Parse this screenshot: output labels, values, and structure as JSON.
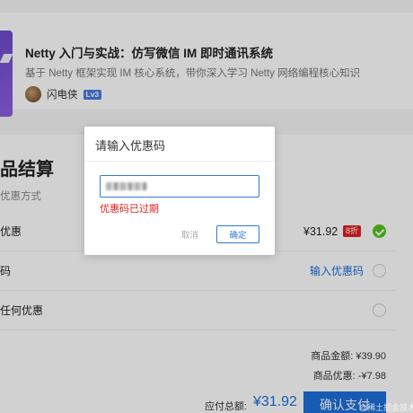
{
  "course": {
    "title": "Netty 入门与实战：仿写微信 IM 即时通讯系统",
    "description": "基于 Netty 框架实现 IM 核心系统，带你深入学习 Netty 网络编程核心知识",
    "author": "闪电侠",
    "level": "Lv3"
  },
  "settlement": {
    "title": "品结算",
    "subtitle": "优惠方式"
  },
  "options": [
    {
      "label": "优惠",
      "price": "¥31.92",
      "badge": "8折",
      "selected": true
    },
    {
      "label": "码",
      "link": "输入优惠码",
      "selected": false
    },
    {
      "label": "任何优惠",
      "selected": false
    }
  ],
  "summary": {
    "goods_amount": "商品金额: ¥39.90",
    "goods_discount": "商品优惠: -¥7.98",
    "total_label": "应付总额:",
    "total_value": "¥31.92",
    "pay_label": "确认支付"
  },
  "dialog": {
    "title": "请输入优惠码",
    "error": "优惠码已过期",
    "cancel_label": "取消",
    "confirm_label": "确定"
  },
  "watermark": "@稀土掘金技术社区",
  "colors": {
    "accent": "#1e6fd9",
    "error": "#e02020",
    "success": "#52c41a"
  }
}
